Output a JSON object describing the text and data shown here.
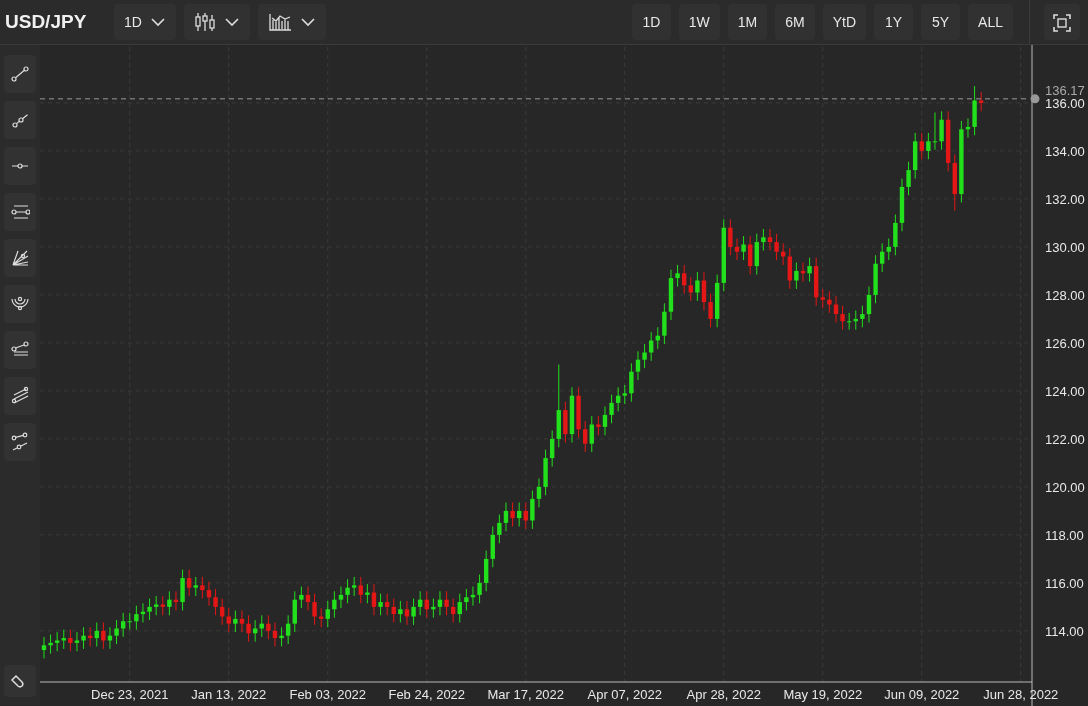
{
  "symbol": "USD/JPY",
  "toolbar": {
    "interval": {
      "label": "1D"
    }
  },
  "range_buttons": [
    {
      "label": "1D"
    },
    {
      "label": "1W"
    },
    {
      "label": "1M"
    },
    {
      "label": "6M"
    },
    {
      "label": "YtD"
    },
    {
      "label": "1Y"
    },
    {
      "label": "5Y"
    },
    {
      "label": "ALL"
    }
  ],
  "drawing_tools": [
    {
      "kind": "line"
    },
    {
      "kind": "ray"
    },
    {
      "kind": "hline"
    },
    {
      "kind": "channel"
    },
    {
      "kind": "fan"
    },
    {
      "kind": "arcs"
    },
    {
      "kind": "pitchfork"
    },
    {
      "kind": "parallel"
    },
    {
      "kind": "segments"
    }
  ],
  "chart": {
    "chart_data": {
      "type": "candlestick",
      "grid": true,
      "categories": [
        null,
        null,
        null,
        null,
        null,
        null,
        null,
        null,
        null,
        null,
        null,
        null,
        null,
        "Dec 23, 2021",
        null,
        null,
        null,
        null,
        null,
        null,
        null,
        null,
        null,
        null,
        null,
        null,
        null,
        null,
        "Jan 13, 2022",
        null,
        null,
        null,
        null,
        null,
        null,
        null,
        null,
        null,
        null,
        null,
        null,
        null,
        null,
        "Feb 03, 2022",
        null,
        null,
        null,
        null,
        null,
        null,
        null,
        null,
        null,
        null,
        null,
        null,
        null,
        null,
        "Feb 24, 2022",
        null,
        null,
        null,
        null,
        null,
        null,
        null,
        null,
        null,
        null,
        null,
        null,
        null,
        null,
        "Mar 17, 2022",
        null,
        null,
        null,
        null,
        null,
        null,
        null,
        null,
        null,
        null,
        null,
        null,
        null,
        null,
        "Apr 07, 2022",
        null,
        null,
        null,
        null,
        null,
        null,
        null,
        null,
        null,
        null,
        null,
        null,
        null,
        null,
        "Apr 28, 2022",
        null,
        null,
        null,
        null,
        null,
        null,
        null,
        null,
        null,
        null,
        null,
        null,
        null,
        null,
        "May 19, 2022",
        null,
        null,
        null,
        null,
        null,
        null,
        null,
        null,
        null,
        null,
        null,
        null,
        null,
        null,
        "Jun 09, 2022",
        null,
        null,
        null,
        null,
        null,
        null,
        null,
        null,
        null,
        null,
        null,
        null,
        null,
        null,
        "Jun 28, 2022",
        null
      ],
      "ohlc": [
        [
          113.2,
          113.75,
          112.85,
          113.4
        ],
        [
          113.4,
          113.85,
          113.05,
          113.5
        ],
        [
          113.5,
          113.95,
          113.15,
          113.6
        ],
        [
          113.6,
          114.05,
          113.25,
          113.7
        ],
        [
          113.7,
          114.05,
          113.15,
          113.5
        ],
        [
          113.5,
          113.95,
          113.15,
          113.6
        ],
        [
          113.6,
          114.15,
          113.25,
          113.8
        ],
        [
          113.8,
          114.15,
          113.35,
          113.7
        ],
        [
          113.7,
          114.35,
          113.35,
          114.0
        ],
        [
          114.0,
          114.35,
          113.25,
          113.6
        ],
        [
          113.6,
          114.15,
          113.25,
          113.8
        ],
        [
          113.8,
          114.45,
          113.45,
          114.1
        ],
        [
          114.1,
          114.75,
          113.75,
          114.4
        ],
        [
          114.4,
          114.75,
          114.05,
          114.4
        ],
        [
          114.4,
          115.05,
          114.05,
          114.7
        ],
        [
          114.7,
          115.15,
          114.35,
          114.8
        ],
        [
          114.8,
          115.35,
          114.45,
          115.0
        ],
        [
          115.0,
          115.45,
          114.65,
          115.1
        ],
        [
          115.1,
          115.45,
          114.65,
          115.0
        ],
        [
          115.0,
          115.65,
          114.65,
          115.3
        ],
        [
          115.3,
          115.65,
          114.85,
          115.2
        ],
        [
          115.2,
          116.55,
          114.85,
          116.2
        ],
        [
          116.2,
          116.55,
          115.45,
          115.8
        ],
        [
          115.8,
          116.25,
          115.45,
          115.9
        ],
        [
          115.9,
          116.25,
          115.35,
          115.7
        ],
        [
          115.7,
          116.05,
          115.05,
          115.4
        ],
        [
          115.4,
          115.75,
          114.65,
          115.0
        ],
        [
          115.0,
          115.35,
          114.25,
          114.6
        ],
        [
          114.6,
          114.95,
          113.95,
          114.3
        ],
        [
          114.3,
          114.85,
          113.95,
          114.5
        ],
        [
          114.5,
          114.85,
          113.95,
          114.3
        ],
        [
          114.3,
          114.65,
          113.55,
          113.9
        ],
        [
          113.9,
          114.45,
          113.55,
          114.1
        ],
        [
          114.1,
          114.65,
          113.75,
          114.3
        ],
        [
          114.3,
          114.65,
          113.65,
          114.0
        ],
        [
          114.0,
          114.35,
          113.35,
          113.7
        ],
        [
          113.7,
          114.15,
          113.35,
          113.8
        ],
        [
          113.8,
          114.65,
          113.45,
          114.3
        ],
        [
          114.3,
          115.65,
          113.95,
          115.3
        ],
        [
          115.3,
          115.85,
          114.95,
          115.5
        ],
        [
          115.5,
          115.85,
          114.85,
          115.2
        ],
        [
          115.2,
          115.55,
          114.25,
          114.6
        ],
        [
          114.6,
          114.95,
          114.15,
          114.5
        ],
        [
          114.5,
          115.25,
          114.15,
          114.9
        ],
        [
          114.9,
          115.65,
          114.55,
          115.3
        ],
        [
          115.3,
          115.85,
          114.95,
          115.5
        ],
        [
          115.5,
          116.15,
          115.15,
          115.8
        ],
        [
          115.8,
          116.25,
          115.45,
          115.9
        ],
        [
          115.9,
          116.25,
          115.15,
          115.5
        ],
        [
          115.5,
          115.95,
          115.15,
          115.6
        ],
        [
          115.6,
          115.95,
          114.65,
          115.0
        ],
        [
          115.0,
          115.55,
          114.65,
          115.2
        ],
        [
          115.2,
          115.55,
          114.65,
          115.0
        ],
        [
          115.0,
          115.35,
          114.35,
          114.7
        ],
        [
          114.7,
          115.25,
          114.35,
          114.9
        ],
        [
          114.9,
          115.25,
          114.25,
          114.6
        ],
        [
          114.6,
          115.35,
          114.25,
          115.0
        ],
        [
          115.0,
          115.65,
          114.65,
          115.3
        ],
        [
          115.3,
          115.65,
          114.55,
          114.9
        ],
        [
          114.9,
          115.35,
          114.55,
          115.0
        ],
        [
          115.0,
          115.65,
          114.65,
          115.3
        ],
        [
          115.3,
          115.65,
          114.65,
          115.0
        ],
        [
          115.0,
          115.35,
          114.35,
          114.7
        ],
        [
          114.7,
          115.55,
          114.35,
          115.2
        ],
        [
          115.2,
          115.75,
          114.85,
          115.4
        ],
        [
          115.4,
          115.85,
          115.05,
          115.5
        ],
        [
          115.5,
          116.35,
          115.15,
          116.0
        ],
        [
          116.0,
          117.35,
          115.65,
          117.0
        ],
        [
          117.0,
          118.35,
          116.65,
          118.0
        ],
        [
          118.0,
          118.85,
          117.65,
          118.5
        ],
        [
          118.5,
          119.35,
          118.15,
          119.0
        ],
        [
          119.0,
          119.35,
          118.35,
          118.7
        ],
        [
          118.7,
          119.35,
          118.35,
          119.0
        ],
        [
          119.0,
          119.35,
          118.25,
          118.6
        ],
        [
          118.6,
          119.85,
          118.25,
          119.5
        ],
        [
          119.5,
          120.35,
          119.15,
          120.0
        ],
        [
          120.0,
          121.55,
          119.65,
          121.2
        ],
        [
          121.2,
          122.35,
          120.85,
          122.0
        ],
        [
          122.0,
          125.1,
          121.65,
          123.2
        ],
        [
          123.2,
          123.55,
          121.85,
          122.2
        ],
        [
          122.2,
          124.15,
          121.85,
          123.8
        ],
        [
          123.8,
          124.15,
          122.05,
          122.4
        ],
        [
          122.4,
          122.75,
          121.45,
          121.8
        ],
        [
          121.8,
          122.95,
          121.45,
          122.6
        ],
        [
          122.6,
          122.95,
          122.15,
          122.5
        ],
        [
          122.5,
          123.35,
          122.15,
          123.0
        ],
        [
          123.0,
          123.85,
          122.65,
          123.5
        ],
        [
          123.5,
          124.15,
          123.15,
          123.8
        ],
        [
          123.8,
          124.25,
          123.45,
          123.9
        ],
        [
          123.9,
          125.15,
          123.55,
          124.8
        ],
        [
          124.8,
          125.65,
          124.45,
          125.3
        ],
        [
          125.3,
          125.95,
          124.95,
          125.6
        ],
        [
          125.6,
          126.45,
          125.25,
          126.1
        ],
        [
          126.1,
          126.65,
          125.75,
          126.3
        ],
        [
          126.3,
          127.65,
          125.95,
          127.3
        ],
        [
          127.3,
          129.05,
          126.95,
          128.7
        ],
        [
          128.7,
          129.25,
          128.35,
          128.9
        ],
        [
          128.9,
          129.25,
          128.05,
          128.4
        ],
        [
          128.4,
          128.75,
          127.75,
          128.1
        ],
        [
          128.1,
          128.95,
          127.75,
          128.6
        ],
        [
          128.6,
          128.95,
          127.35,
          127.7
        ],
        [
          127.7,
          128.05,
          126.65,
          127.0
        ],
        [
          127.0,
          128.85,
          126.65,
          128.5
        ],
        [
          128.5,
          131.15,
          128.15,
          130.8
        ],
        [
          130.8,
          131.15,
          129.65,
          130.0
        ],
        [
          130.0,
          130.35,
          129.45,
          129.8
        ],
        [
          129.8,
          130.45,
          129.45,
          130.1
        ],
        [
          130.1,
          130.45,
          128.85,
          129.2
        ],
        [
          129.2,
          130.55,
          128.85,
          130.2
        ],
        [
          130.2,
          130.75,
          129.85,
          130.4
        ],
        [
          130.4,
          130.75,
          129.85,
          130.2
        ],
        [
          130.2,
          130.55,
          129.45,
          129.8
        ],
        [
          129.8,
          130.15,
          129.25,
          129.6
        ],
        [
          129.6,
          129.95,
          128.25,
          128.6
        ],
        [
          128.6,
          129.35,
          128.25,
          129.0
        ],
        [
          129.0,
          129.35,
          128.55,
          128.9
        ],
        [
          128.9,
          129.55,
          128.55,
          129.2
        ],
        [
          129.2,
          129.55,
          127.55,
          127.9
        ],
        [
          127.9,
          128.25,
          127.45,
          127.8
        ],
        [
          127.8,
          128.15,
          127.25,
          127.6
        ],
        [
          127.6,
          127.95,
          126.85,
          127.2
        ],
        [
          127.2,
          127.55,
          126.55,
          126.9
        ],
        [
          126.9,
          127.25,
          126.55,
          126.9
        ],
        [
          126.9,
          127.35,
          126.55,
          127.0
        ],
        [
          127.0,
          127.55,
          126.65,
          127.2
        ],
        [
          127.2,
          128.35,
          126.85,
          128.0
        ],
        [
          128.0,
          129.65,
          127.65,
          129.3
        ],
        [
          129.3,
          130.15,
          128.95,
          129.8
        ],
        [
          129.8,
          130.35,
          129.45,
          130.0
        ],
        [
          130.0,
          131.35,
          129.65,
          131.0
        ],
        [
          131.0,
          132.85,
          130.65,
          132.5
        ],
        [
          132.5,
          133.55,
          132.15,
          133.2
        ],
        [
          133.2,
          134.75,
          132.85,
          134.4
        ],
        [
          134.4,
          134.75,
          133.65,
          134.0
        ],
        [
          134.0,
          134.75,
          133.65,
          134.4
        ],
        [
          134.4,
          135.6,
          134.05,
          134.4
        ],
        [
          134.4,
          135.65,
          134.05,
          135.3
        ],
        [
          135.3,
          135.65,
          133.15,
          133.5
        ],
        [
          133.5,
          133.85,
          131.5,
          132.2
        ],
        [
          132.2,
          135.25,
          131.85,
          134.9
        ],
        [
          134.9,
          135.35,
          134.55,
          135.0
        ],
        [
          135.0,
          136.7,
          134.65,
          136.1
        ],
        [
          136.1,
          136.45,
          135.65,
          136.0
        ],
        null,
        null,
        null,
        null,
        null,
        null,
        null
      ],
      "ylim": [
        111.87,
        138.33
      ],
      "yticks": [
        {
          "value": 114,
          "label": "114.00"
        },
        {
          "value": 116,
          "label": "116.00"
        },
        {
          "value": 118,
          "label": "118.00"
        },
        {
          "value": 120,
          "label": "120.00"
        },
        {
          "value": 122,
          "label": "122.00"
        },
        {
          "value": 124,
          "label": "124.00"
        },
        {
          "value": 126,
          "label": "126.00"
        },
        {
          "value": 128,
          "label": "128.00"
        },
        {
          "value": 130,
          "label": "130.00"
        },
        {
          "value": 132,
          "label": "132.00"
        },
        {
          "value": 134,
          "label": "134.00"
        },
        {
          "value": 136,
          "label": "136.00"
        }
      ],
      "ref_lines": [
        {
          "axis": "y",
          "value": 136.17,
          "label": "136.17"
        }
      ]
    }
  }
}
